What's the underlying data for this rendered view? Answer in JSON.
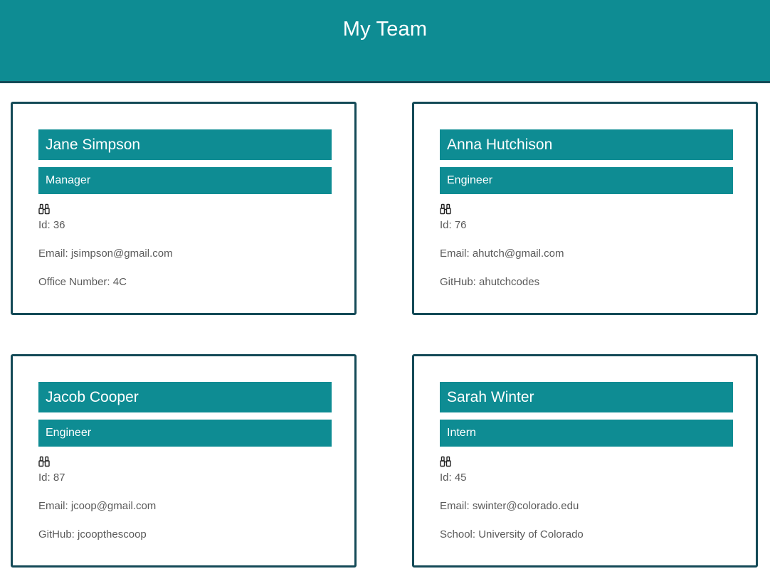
{
  "header": {
    "title": "My Team"
  },
  "colors": {
    "accent": "#0e8c93",
    "border": "#144a57",
    "text": "#5a5a5a"
  },
  "cards": [
    {
      "name": "Jane Simpson",
      "role": "Manager",
      "icon": "binoculars-icon",
      "id": "Id: 36",
      "email": "Email: jsimpson@gmail.com",
      "extra": "Office Number: 4C"
    },
    {
      "name": "Anna Hutchison",
      "role": "Engineer",
      "icon": "binoculars-icon",
      "id": "Id: 76",
      "email": "Email: ahutch@gmail.com",
      "extra": "GitHub: ahutchcodes"
    },
    {
      "name": "Jacob Cooper",
      "role": "Engineer",
      "icon": "binoculars-icon",
      "id": "Id: 87",
      "email": "Email: jcoop@gmail.com",
      "extra": "GitHub: jcoopthescoop"
    },
    {
      "name": "Sarah Winter",
      "role": "Intern",
      "icon": "binoculars-icon",
      "id": "Id: 45",
      "email": "Email: swinter@colorado.edu",
      "extra": "School: University of Colorado"
    }
  ]
}
